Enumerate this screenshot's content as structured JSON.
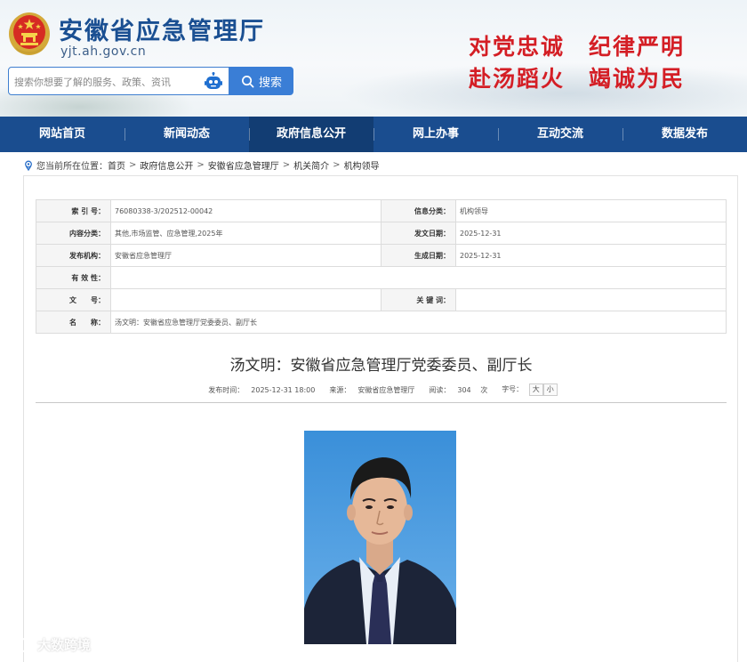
{
  "header": {
    "site_name": "安徽省应急管理厅",
    "domain": "yjt.ah.gov.cn",
    "search_placeholder": "搜索你想要了解的服务、政策、资讯",
    "search_button": "搜索",
    "slogans": [
      "对党忠诚",
      "纪律严明",
      "赴汤蹈火",
      "竭诚为民"
    ]
  },
  "nav": {
    "items": [
      "网站首页",
      "新闻动态",
      "政府信息公开",
      "网上办事",
      "互动交流",
      "数据发布"
    ],
    "active": "政府信息公开"
  },
  "breadcrumb": {
    "prefix": "您当前所在位置：",
    "items": [
      "首页",
      "政府信息公开",
      "安徽省应急管理厅",
      "机关简介",
      "机构领导"
    ],
    "separator": ">"
  },
  "info_table": {
    "index_label": "索 引 号：",
    "index_value": "76080338-3/202512-00042",
    "category_label": "信息分类：",
    "category_value": "机构领导",
    "content_class_label": "内容分类：",
    "content_class_value": "其他,市场监管、应急管理,2025年",
    "issue_date_label": "发文日期：",
    "issue_date_value": "2025-12-31",
    "publisher_label": "发布机构：",
    "publisher_value": "安徽省应急管理厅",
    "effective_date_label": "生成日期：",
    "effective_date_value": "2025-12-31",
    "validity_label": "有 效 性：",
    "validity_value": "",
    "doc_no_label": "文　　号：",
    "doc_no_value": "",
    "keywords_label": "关 键 词：",
    "keywords_value": "",
    "name_label": "名　　称：",
    "name_value": "汤文明：安徽省应急管理厅党委委员、副厅长"
  },
  "article": {
    "title": "汤文明：安徽省应急管理厅党委委员、副厅长",
    "publish_time_label": "发布时间：",
    "publish_time": "2025-12-31 18:00",
    "source_label": "来源：",
    "source": "安徽省应急管理厅",
    "reads_label": "阅读：",
    "reads": "304",
    "reads_unit": "次",
    "font_size_label": "字号：",
    "font_large": "大",
    "font_small": "小"
  },
  "watermark": "大数跨境",
  "colors": {
    "nav_bg": "#1a4d8f",
    "nav_active": "#123d73",
    "title_blue": "#1a4f92",
    "slogan_red": "#d41e25",
    "search_blue": "#3a7ed6"
  }
}
